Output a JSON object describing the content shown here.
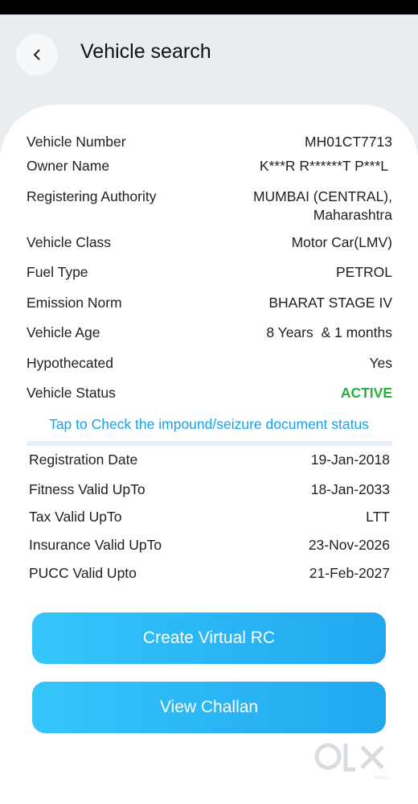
{
  "header": {
    "title": "Vehicle search"
  },
  "details": [
    {
      "label": "Vehicle Number",
      "value": "MH01CT7713"
    },
    {
      "label": "Owner Name",
      "value": "K***R R******T P***L"
    },
    {
      "label": "Registering Authority",
      "value": "MUMBAI (CENTRAL),",
      "value2": "Maharashtra"
    },
    {
      "label": "Vehicle Class",
      "value": "Motor Car(LMV)"
    },
    {
      "label": "Fuel Type",
      "value": "PETROL"
    },
    {
      "label": "Emission Norm",
      "value": "BHARAT STAGE IV"
    },
    {
      "label": "Vehicle Age",
      "value": "8 Years  & 1 months"
    },
    {
      "label": "Hypothecated",
      "value": "Yes"
    },
    {
      "label": "Vehicle Status",
      "value": "ACTIVE"
    }
  ],
  "tap_link": "Tap to Check the impound/seizure document status",
  "validity": [
    {
      "label": "Registration Date",
      "value": "19-Jan-2018"
    },
    {
      "label": "Fitness Valid UpTo",
      "value": "18-Jan-2033"
    },
    {
      "label": "Tax Valid UpTo",
      "value": "LTT"
    },
    {
      "label": "Insurance Valid UpTo",
      "value": "23-Nov-2026"
    },
    {
      "label": "PUCC Valid Upto",
      "value": "21-Feb-2027"
    }
  ],
  "buttons": {
    "create_rc": "Create Virtual RC",
    "view_challan": "View Challan"
  },
  "colors": {
    "accent": "#21a8f0",
    "active": "#23b23a",
    "link": "#1aa1e8"
  },
  "watermark": {
    "brand": "OLX",
    "sub": "INDIA"
  }
}
